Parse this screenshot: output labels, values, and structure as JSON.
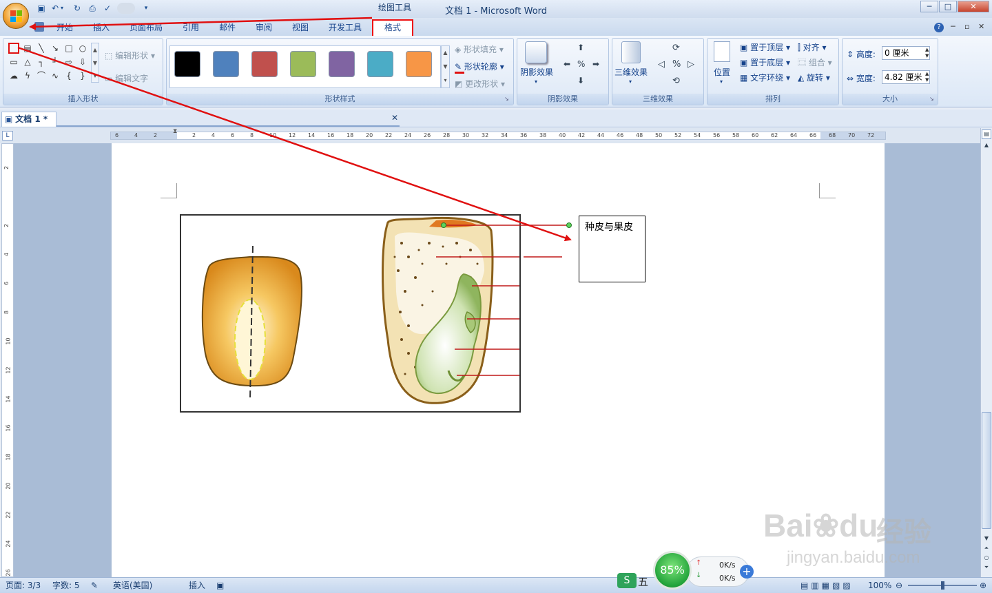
{
  "window": {
    "title": "文档 1 - Microsoft Word",
    "context_tab_group": "绘图工具",
    "min_label": "─",
    "max_label": "□",
    "close_label": "✕"
  },
  "tabs": [
    "开始",
    "插入",
    "页面布局",
    "引用",
    "邮件",
    "审阅",
    "视图",
    "开发工具",
    "格式"
  ],
  "ribbon": {
    "insert_shapes": {
      "label": "插入形状",
      "edit_shape": "编辑形状",
      "edit_text": "编辑文字"
    },
    "shape_styles": {
      "label": "形状样式",
      "swatches": [
        "#000000",
        "#4f81bd",
        "#c0504d",
        "#9bbb59",
        "#8064a2",
        "#4bacc6",
        "#f79646"
      ],
      "fill": "形状填充",
      "outline": "形状轮廓",
      "change": "更改形状"
    },
    "shadow": {
      "label": "阴影效果",
      "button": "阴影效果"
    },
    "threed": {
      "label": "三维效果",
      "button": "三维效果"
    },
    "arrange": {
      "label": "排列",
      "position": "位置",
      "bring_front": "置于顶层",
      "send_back": "置于底层",
      "wrap": "文字环绕",
      "align": "对齐",
      "group": "组合",
      "rotate": "旋转"
    },
    "size": {
      "label": "大小",
      "height_label": "高度:",
      "height_value": "0 厘米",
      "width_label": "宽度:",
      "width_value": "4.82 厘米"
    }
  },
  "document_tab": {
    "name": "文档 1 *"
  },
  "ruler_numbers": [
    "6",
    "4",
    "2",
    "",
    "2",
    "4",
    "6",
    "8",
    "10",
    "12",
    "14",
    "16",
    "18",
    "20",
    "22",
    "24",
    "26",
    "28",
    "30",
    "32",
    "34",
    "36",
    "38",
    "40",
    "42",
    "44",
    "46",
    "48",
    "50",
    "52",
    "54",
    "56",
    "58",
    "60",
    "62",
    "64",
    "66",
    "68",
    "70",
    "72"
  ],
  "vruler_numbers": [
    "2",
    "",
    "2",
    "4",
    "6",
    "8",
    "10",
    "12",
    "14",
    "16",
    "18",
    "20",
    "22",
    "24",
    "26"
  ],
  "textbox": {
    "text": "种皮与果皮"
  },
  "status": {
    "page": "页面: 3/3",
    "words": "字数: 5",
    "language": "英语(美国)",
    "mode": "插入",
    "zoom": "100%"
  },
  "speed_widget": {
    "percent": "85%",
    "up": "0K/s",
    "down": "0K/s",
    "ime": "五"
  },
  "watermark": {
    "brand": "Bai",
    "brand2": "du",
    "suffix": "经验",
    "url": "jingyan.baidu.com"
  },
  "colors": {
    "annotation_red": "#e01010",
    "ribbon_blue": "#15428b"
  }
}
